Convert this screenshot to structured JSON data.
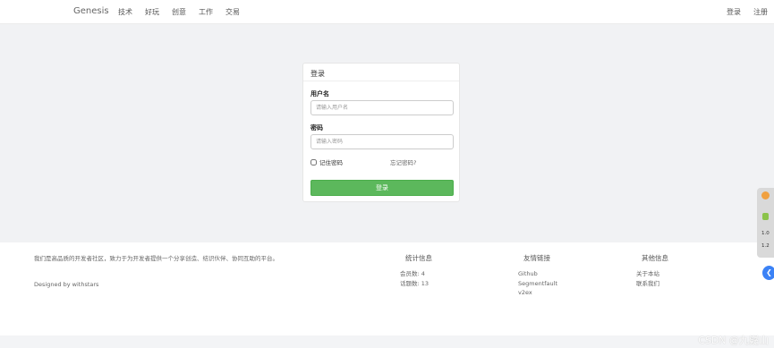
{
  "header": {
    "brand": "Genesis",
    "nav": [
      "技术",
      "好玩",
      "创意",
      "工作",
      "交易"
    ],
    "right": [
      "登录",
      "注册"
    ]
  },
  "login": {
    "title": "登录",
    "username_label": "用户名",
    "username_placeholder": "请输入用户名",
    "password_label": "密码",
    "password_placeholder": "请输入密码",
    "remember_label": "记住密码",
    "forgot_label": "忘记密码?",
    "submit_label": "登录",
    "button_color": "#5cb85c"
  },
  "footer": {
    "about": "我们是高品质的开发者社区，致力于为开发者提供一个分享创造、结识伙伴、协同互助的平台。",
    "designed": "Designed by withstars",
    "stats": {
      "title": "统计信息",
      "items": [
        "会员数: 4",
        "话题数: 13"
      ]
    },
    "links": {
      "title": "友情链接",
      "items": [
        "Github",
        "Segmentfault",
        "v2ex"
      ]
    },
    "other": {
      "title": "其他信息",
      "items": [
        "关于本站",
        "联系我们"
      ]
    }
  },
  "float_panel": {
    "text1": "1.0",
    "text2": "1.2"
  },
  "blue_button": {
    "icon": "chevron-left-icon",
    "glyph": "❮"
  },
  "watermark": "CSDN @九嶷山"
}
